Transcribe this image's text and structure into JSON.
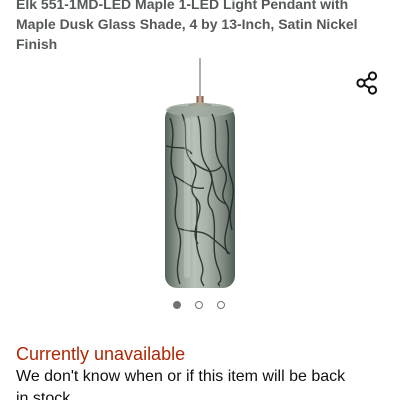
{
  "product": {
    "title_line1": "Elk 551-1MD-LED Maple 1-LED Light Pendant with",
    "title_line2": "Maple Dusk Glass Shade, 4 by 13-Inch, Satin Nickel",
    "title_line3": "Finish"
  },
  "actions": {
    "share_icon": "share-icon"
  },
  "gallery": {
    "image_subject": "pendant-light-image",
    "pages": 3,
    "current_page": 1
  },
  "availability": {
    "status": "Currently unavailable",
    "note_line1": "We don't know when or if this item will be back",
    "note_line2": "in stock."
  },
  "colors": {
    "unavailable": "#b12704",
    "text_secondary": "#565959",
    "text_primary": "#0f1111"
  }
}
